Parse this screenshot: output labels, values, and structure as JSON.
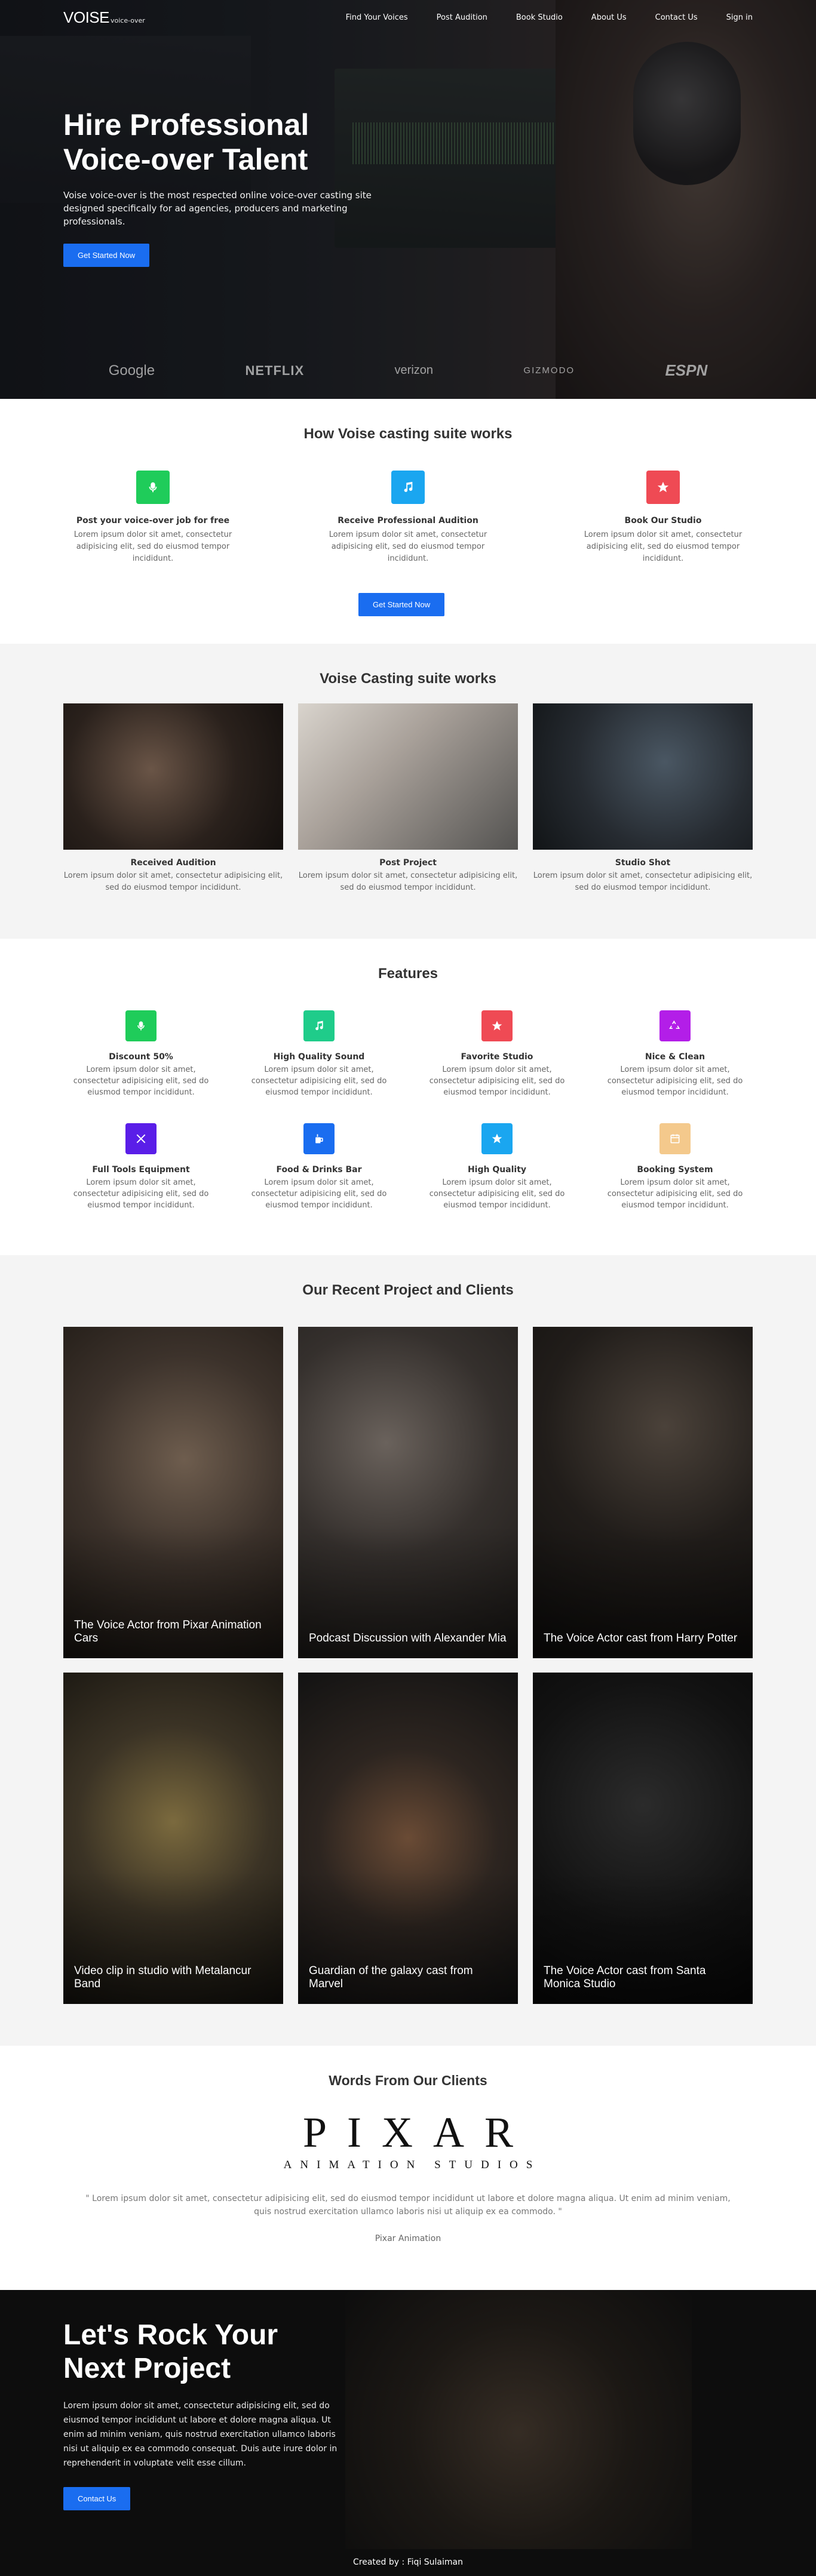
{
  "nav": {
    "logo_main": "VOISE",
    "logo_sub": "voice-over",
    "links": [
      "Find Your Voices",
      "Post Audition",
      "Book Studio",
      "About Us",
      "Contact Us",
      "Sign in"
    ]
  },
  "hero": {
    "title_line1": "Hire Professional",
    "title_line2": "Voice-over Talent",
    "description": "Voise voice-over is the most respected online voice-over casting site designed specifically for ad agencies, producers and marketing professionals.",
    "cta_label": "Get Started Now",
    "brands": [
      "Google",
      "NETFLIX",
      "verizon",
      "GIZMODO",
      "ESPN"
    ]
  },
  "how_it_works": {
    "title": "How Voise casting suite works",
    "steps": [
      {
        "title": "Post your voice-over job for free",
        "text": "Lorem ipsum dolor sit amet, consectetur adipisicing elit, sed do eiusmod tempor incididunt.",
        "icon": "microphone-icon",
        "color": "#1fcc5a"
      },
      {
        "title": "Receive Professional Audition",
        "text": "Lorem ipsum dolor sit amet, consectetur adipisicing elit, sed do eiusmod tempor incididunt.",
        "icon": "music-icon",
        "color": "#1aa6f0"
      },
      {
        "title": "Book Our Studio",
        "text": "Lorem ipsum dolor sit amet, consectetur adipisicing elit, sed do eiusmod tempor incididunt.",
        "icon": "star-icon",
        "color": "#ef4a54"
      }
    ],
    "cta_label": "Get Started Now"
  },
  "suite": {
    "title": "Voise Casting suite works",
    "cards": [
      {
        "title": "Received Audition",
        "text": "Lorem ipsum dolor sit amet, consectetur adipisicing elit, sed do eiusmod tempor incididunt."
      },
      {
        "title": "Post Project",
        "text": "Lorem ipsum dolor sit amet, consectetur adipisicing elit, sed do eiusmod tempor incididunt."
      },
      {
        "title": "Studio Shot",
        "text": "Lorem ipsum dolor sit amet, consectetur adipisicing elit, sed do eiusmod tempor incididunt."
      }
    ]
  },
  "features": {
    "title": "Features",
    "items": [
      {
        "title": "Discount 50%",
        "text": "Lorem ipsum dolor sit amet, consectetur adipisicing elit, sed do eiusmod tempor incididunt.",
        "icon": "microphone-icon",
        "color": "#1fcc5a"
      },
      {
        "title": "High Quality Sound",
        "text": "Lorem ipsum dolor sit amet, consectetur adipisicing elit, sed do eiusmod tempor incididunt.",
        "icon": "music-icon",
        "color": "#1fcc8a"
      },
      {
        "title": "Favorite Studio",
        "text": "Lorem ipsum dolor sit amet, consectetur adipisicing elit, sed do eiusmod tempor incididunt.",
        "icon": "star-icon",
        "color": "#ef4a54"
      },
      {
        "title": "Nice & Clean",
        "text": "Lorem ipsum dolor sit amet, consectetur adipisicing elit, sed do eiusmod tempor incididunt.",
        "icon": "recycle-icon",
        "color": "#b31ee8"
      },
      {
        "title": "Full Tools Equipment",
        "text": "Lorem ipsum dolor sit amet, consectetur adipisicing elit, sed do eiusmod tempor incididunt.",
        "icon": "tools-icon",
        "color": "#5a1ee8"
      },
      {
        "title": "Food & Drinks Bar",
        "text": "Lorem ipsum dolor sit amet, consectetur adipisicing elit, sed do eiusmod tempor incididunt.",
        "icon": "drink-icon",
        "color": "#1a6df0"
      },
      {
        "title": "High Quality",
        "text": "Lorem ipsum dolor sit amet, consectetur adipisicing elit, sed do eiusmod tempor incididunt.",
        "icon": "star-icon",
        "color": "#1aa6f0"
      },
      {
        "title": "Booking System",
        "text": "Lorem ipsum dolor sit amet, consectetur adipisicing elit, sed do eiusmod tempor incididunt.",
        "icon": "calendar-icon",
        "color": "#f4c98c"
      }
    ]
  },
  "recent": {
    "title": "Our Recent Project and Clients",
    "projects": [
      {
        "label": "The Voice Actor from Pixar Animation Cars"
      },
      {
        "label": "Podcast Discussion with Alexander Mia"
      },
      {
        "label": "The Voice Actor cast from Harry Potter"
      },
      {
        "label": "Video clip in studio with Metalancur Band"
      },
      {
        "label": "Guardian of the galaxy cast from Marvel"
      },
      {
        "label": "The Voice Actor cast from Santa Monica Studio"
      }
    ]
  },
  "testimonial": {
    "title": "Words From Our Clients",
    "logo_main": "PIXAR",
    "logo_sub": "ANIMATION STUDIOS",
    "quote": "\" Lorem ipsum dolor sit amet, consectetur adipisicing elit, sed do eiusmod tempor incididunt ut labore et dolore magna aliqua. Ut enim ad minim veniam, quis nostrud exercitation ullamco laboris nisi ut aliquip ex ea commodo. \"",
    "author": "Pixar Animation"
  },
  "cta": {
    "title_line1": "Let's Rock Your",
    "title_line2": "Next Project",
    "text": "Lorem ipsum dolor sit amet, consectetur adipisicing elit, sed do eiusmod tempor incididunt ut labore et dolore magna aliqua. Ut enim ad minim veniam, quis nostrud exercitation ullamco laboris nisi ut aliquip ex ea commodo consequat. Duis aute irure dolor in reprehenderit in voluptate velit esse cillum.",
    "button_label": "Contact Us"
  },
  "footer": {
    "credit": "Created by : Fiqi Sulaiman"
  }
}
